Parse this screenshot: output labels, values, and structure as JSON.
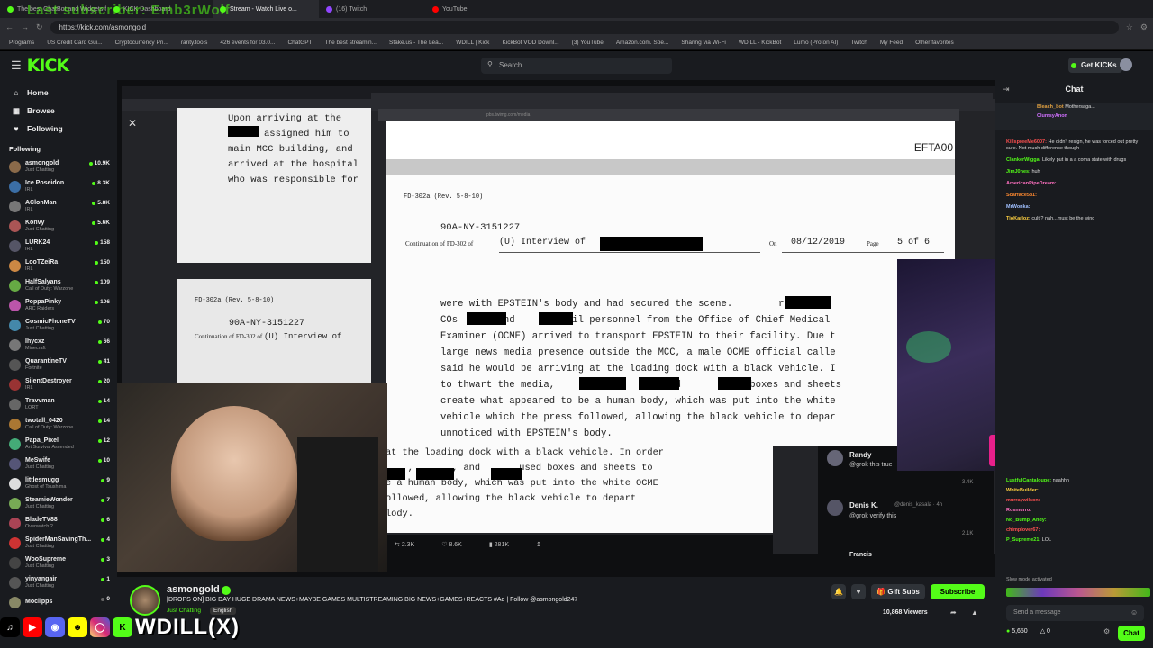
{
  "overlay_title": "Last subscriber: Emb3rWolf",
  "browser": {
    "tabs": [
      {
        "label": "The best ChatBot and Widgets for",
        "color": "#53fc18"
      },
      {
        "label": "KICK Dashboard",
        "color": "#53fc18"
      },
      {
        "label": "Stream - Watch Live o...",
        "color": "#53fc18"
      },
      {
        "label": "(16) Twitch",
        "color": "#9146ff"
      },
      {
        "label": "YouTube",
        "color": "#ff0000"
      }
    ],
    "url": "https://kick.com/asmongold",
    "bookmarks": [
      "Programs",
      "US Credit Card Gui...",
      "Cryptocurrency Pri...",
      "rarity.tools",
      "426 events for 03.0...",
      "ChatGPT",
      "The best streamin...",
      "Stake.us - The Lea...",
      "WDILL | Kick",
      "KickBot VOD Downl...",
      "(3) YouTube",
      "Amazon.com. Spe...",
      "Sharing via Wi-Fi",
      "WDILL - KickBot",
      "Lumo (Proton AI)",
      "Twitch",
      "My Feed",
      "Other favorites"
    ]
  },
  "header": {
    "logo": "KICK",
    "search_placeholder": "Search",
    "get_kicks": "Get KICKs"
  },
  "sidebar": {
    "nav": [
      {
        "label": "Home",
        "icon": "home-icon"
      },
      {
        "label": "Browse",
        "icon": "browse-icon"
      },
      {
        "label": "Following",
        "icon": "heart-icon"
      }
    ],
    "following_header": "Following",
    "channels": [
      {
        "name": "asmongold",
        "category": "Just Chatting",
        "count": "10.9K",
        "live": true,
        "color": "#8a6a4a"
      },
      {
        "name": "Ice Poseidon",
        "category": "IRL",
        "count": "8.3K",
        "live": true,
        "color": "#3b6ea5"
      },
      {
        "name": "AClonMan",
        "category": "IRL",
        "count": "5.8K",
        "live": true,
        "color": "#777"
      },
      {
        "name": "Konvy",
        "category": "Just Chatting",
        "count": "5.6K",
        "live": true,
        "color": "#a55"
      },
      {
        "name": "LURK24",
        "category": "IRL",
        "count": "158",
        "live": true,
        "color": "#556"
      },
      {
        "name": "LooTZeiRa",
        "category": "IRL",
        "count": "150",
        "live": true,
        "color": "#c84"
      },
      {
        "name": "HalfSalyans",
        "category": "Call of Duty: Warzone",
        "count": "109",
        "live": true,
        "color": "#6a4"
      },
      {
        "name": "PoppaPinky",
        "category": "ARC Raiders",
        "count": "106",
        "live": true,
        "color": "#b5a"
      },
      {
        "name": "CosmicPhoneTV",
        "category": "Just Chatting",
        "count": "70",
        "live": true,
        "color": "#48a"
      },
      {
        "name": "Ihycxz",
        "category": "Minecraft",
        "count": "66",
        "live": true,
        "color": "#777"
      },
      {
        "name": "QuarantineTV",
        "category": "Fortnite",
        "count": "41",
        "live": true,
        "color": "#555"
      },
      {
        "name": "SilentDestroyer",
        "category": "IRL",
        "count": "20",
        "live": true,
        "color": "#933"
      },
      {
        "name": "Travvman",
        "category": "LORT",
        "count": "14",
        "live": true,
        "color": "#666"
      },
      {
        "name": "twotall_0420",
        "category": "Call of Duty: Warzone",
        "count": "14",
        "live": true,
        "color": "#a73"
      },
      {
        "name": "Papa_Pixel",
        "category": "Art Survival Ascended",
        "count": "12",
        "live": true,
        "color": "#4a7"
      },
      {
        "name": "MeSwife",
        "category": "Just Chatting",
        "count": "10",
        "live": true,
        "color": "#557"
      },
      {
        "name": "littlesmugg",
        "category": "Ghost of Tsushima",
        "count": "9",
        "live": true,
        "color": "#ddd"
      },
      {
        "name": "SteamieWonder",
        "category": "Just Chatting",
        "count": "7",
        "live": true,
        "color": "#7a5"
      },
      {
        "name": "BladeTV88",
        "category": "Overwatch 2",
        "count": "6",
        "live": true,
        "color": "#a45"
      },
      {
        "name": "SpiderManSavingTh...",
        "category": "Just Chatting",
        "count": "4",
        "live": true,
        "color": "#c33"
      },
      {
        "name": "WooSupreme",
        "category": "Just Chatting",
        "count": "3",
        "live": true,
        "color": "#444"
      },
      {
        "name": "yinyangair",
        "category": "Just Chatting",
        "count": "1",
        "live": true,
        "color": "#555"
      },
      {
        "name": "Moclipps",
        "category": "",
        "count": "0",
        "live": false,
        "color": "#886"
      }
    ]
  },
  "document_left": {
    "lines": [
      "Upon arriving at the",
      "assigned him to",
      "main MCC building, and",
      "arrived at the hospital",
      "who was responsible for"
    ],
    "form": "FD-302a (Rev. 5-8-10)",
    "file_no": "90A-NY-3151227",
    "continuation": "Continuation of FD-302 of",
    "interview": "(U) Interview of"
  },
  "document_main": {
    "efta": "EFTA00",
    "form": "FD-302a (Rev. 5-8-10)",
    "file_no": "90A-NY-3151227",
    "continuation": "Continuation of FD-302 of",
    "interview": "(U) Interview of",
    "on_label": "On",
    "date": "08/12/2019",
    "page_label": "Page",
    "page": "5 of 6",
    "body": [
      "were with EPSTEIN's body and had secured the scene.        remained",
      "COs       and       until personnel from the Office of Chief Medical",
      "Examiner (OCME) arrived to transport EPSTEIN to their facility. Due t",
      "large news media presence outside the MCC, a male OCME official calle",
      "said he would be arriving at the loading dock with a black vehicle. I",
      "to thwart the media,        ,        , and       used boxes and sheets",
      "create what appeared to be a human body, which was put into the white",
      "vehicle which the press followed, allowing the black vehicle to depar",
      "unnoticed with EPSTEIN's body."
    ]
  },
  "document_bottom": {
    "lines": [
      "at the loading dock with a black vehicle. In order",
      "    ,       , and       used boxes and sheets to",
      "e a human body, which was put into the white OCME",
      "ollowed, allowing the black vehicle to depart",
      "lody."
    ],
    "stats": {
      "retweets": "2.3K",
      "likes": "8.6K",
      "views": "281K"
    }
  },
  "tweets": [
    {
      "name": "Randy",
      "text": "@grok this true"
    },
    {
      "name": "Denis K.",
      "handle": "@denis_kasala · 4h",
      "text": "@grok verify this"
    },
    {
      "name": "Francis",
      "text": ""
    }
  ],
  "tweet_stats": {
    "a": "3.4K",
    "b": "2.1K"
  },
  "streamer": {
    "name": "asmongold",
    "title": "[DROPS ON] BIG DAY HUGE DRAMA NEWS+MAYBE GAMES MULTISTREAMING BIG NEWS+GAMES+REACTS #Ad | Follow @asmongold247",
    "category": "Just Chatting",
    "language": "English",
    "viewers": "10,868 Viewers",
    "gift_subs": "Gift Subs",
    "subscribe": "Subscribe"
  },
  "overlay_handle": "WDILL(X)",
  "chat": {
    "title": "Chat",
    "pinned": [
      {
        "user": "Bleach_bot",
        "text": "Mothersaga...",
        "color": "#e0a040"
      },
      {
        "user": "ClumsyAnon",
        "text": "",
        "color": "#d070ff"
      }
    ],
    "messages": [
      {
        "user": "KillspreeMe6007:",
        "text": "He didn't resign, he was forced out pretty sure. Not much difference though",
        "color": "#ff5050"
      },
      {
        "user": "ClankerWigga:",
        "text": "Likely put in a a coma state with drugs",
        "color": "#53fc18"
      },
      {
        "user": "JimJ0nes:",
        "text": "huh",
        "color": "#53fc18"
      },
      {
        "user": "AmericanPipeDream:",
        "text": "",
        "color": "#ff70c0"
      },
      {
        "user": "Scarface581:",
        "text": "",
        "color": "#ff8a30"
      },
      {
        "user": "MrWonka:",
        "text": "",
        "color": "#a0c0ff"
      },
      {
        "user": "TioKarloz:",
        "text": "cult ? nah...must be the wind",
        "color": "#ffd040"
      }
    ],
    "messages_low": [
      {
        "user": "LustfulCantaloupe:",
        "text": "naahhh",
        "color": "#53fc18"
      },
      {
        "user": "WhiteBuilder:",
        "text": "",
        "color": "#ffd040"
      },
      {
        "user": "murraywilson:",
        "text": "",
        "color": "#ff5050"
      },
      {
        "user": "Rosmurro:",
        "text": "",
        "color": "#ff70c0"
      },
      {
        "user": "No_Bump_Andy:",
        "text": "",
        "color": "#53fc18"
      },
      {
        "user": "chimplover67:",
        "text": "",
        "color": "#ff5050"
      },
      {
        "user": "P_Supreme21:",
        "text": "LOL",
        "color": "#53fc18"
      }
    ],
    "slow_mode": "Slow mode activated",
    "input_placeholder": "Send a message",
    "kicks": "5,650",
    "kick_zero": "0",
    "chat_button": "Chat"
  },
  "colors": {
    "accent": "#53fc18",
    "bg": "#191b1f"
  }
}
